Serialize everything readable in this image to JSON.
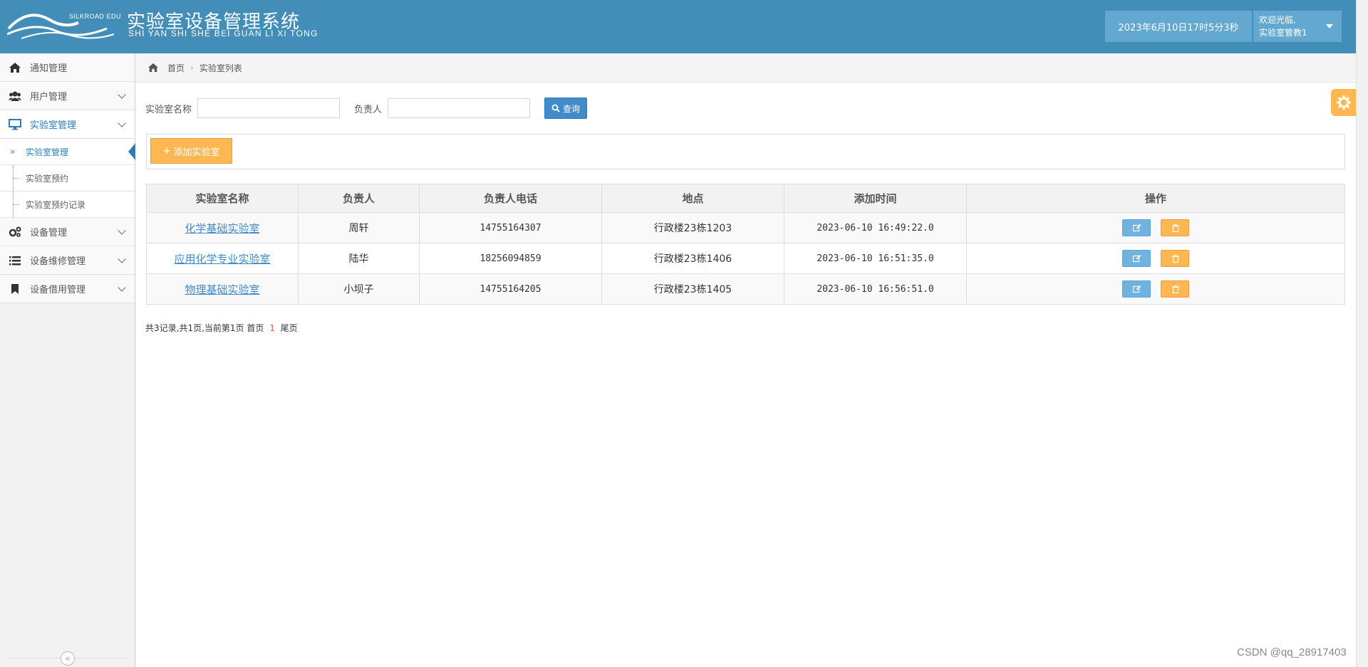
{
  "header": {
    "logo_edu": "SILKROAD EDU",
    "title": "实验室设备管理系统",
    "pinyin": "SHI YAN SHI SHE BEI GUAN LI XI TONG",
    "datetime": "2023年6月10日17时5分3秒",
    "welcome": "欢迎光临,",
    "user": "实验室管教1"
  },
  "sidebar": {
    "items": [
      {
        "label": "通知管理",
        "icon": "home-icon"
      },
      {
        "label": "用户管理",
        "icon": "users-icon"
      },
      {
        "label": "实验室管理",
        "icon": "desktop-icon"
      },
      {
        "label": "设备管理",
        "icon": "cogs-icon"
      },
      {
        "label": "设备维修管理",
        "icon": "list-icon"
      },
      {
        "label": "设备借用管理",
        "icon": "bookmark-icon"
      }
    ],
    "sub_items": [
      "实验室管理",
      "实验室预约",
      "实验室预约记录"
    ],
    "collapse": "«"
  },
  "breadcrumb": {
    "home": "首页",
    "current": "实验室列表"
  },
  "search": {
    "name_label": "实验室名称",
    "name_value": "",
    "person_label": "负责人",
    "person_value": "",
    "query_label": "查询"
  },
  "toolbar": {
    "add_label": "添加实验室"
  },
  "table": {
    "headers": [
      "实验室名称",
      "负责人",
      "负责人电话",
      "地点",
      "添加时间",
      "操作"
    ],
    "rows": [
      {
        "name": "化学基础实验室",
        "person": "周轩",
        "phone": "14755164307",
        "location": "行政楼23栋1203",
        "time": "2023-06-10 16:49:22.0"
      },
      {
        "name": "应用化学专业实验室",
        "person": "陆华",
        "phone": "18256094859",
        "location": "行政楼23栋1406",
        "time": "2023-06-10 16:51:35.0"
      },
      {
        "name": "物理基础实验室",
        "person": "小坝子",
        "phone": "14755164205",
        "location": "行政楼23栋1405",
        "time": "2023-06-10 16:56:51.0"
      }
    ]
  },
  "pager": {
    "summary": "共3记录,共1页,当前第1页 首页",
    "current": "1",
    "last": "尾页"
  },
  "watermark": "CSDN @qq_28917403",
  "colors": {
    "header": "#438eb9",
    "accent": "#2b7dbc",
    "warning": "#ffb752",
    "primary": "#428bca"
  }
}
